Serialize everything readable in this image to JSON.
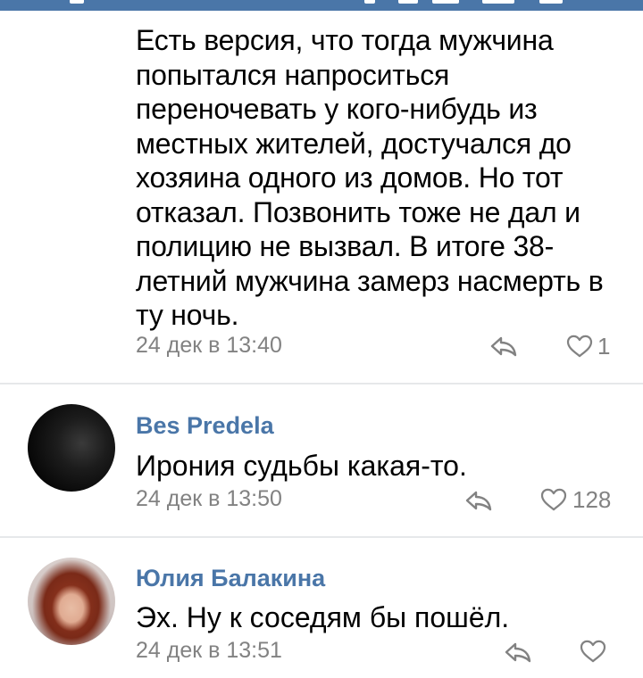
{
  "status_bar": {
    "color": "#4a76a8"
  },
  "colors": {
    "link": "#4a76a8",
    "meta": "#828282",
    "text": "#000000",
    "divider": "#e6e8ea"
  },
  "comments": [
    {
      "text": "Есть версия, что тогда мужчина попытался напроситься переночевать у кого-нибудь из местных жителей, достучался до хозяина одного из домов. Но тот отказал. Позвонить тоже не дал и полицию не вызвал. В итоге 38-летний мужчина замерз насмерть в ту ночь.",
      "time": "24 дек в 13:40",
      "likes": "1",
      "icons": {
        "reply": "reply-arrow-icon",
        "like": "heart-icon"
      }
    },
    {
      "author": "Bes Predela",
      "text": "Ирония судьбы какая-то.",
      "time": "24 дек в 13:50",
      "likes": "128",
      "icons": {
        "reply": "reply-arrow-icon",
        "like": "heart-icon"
      }
    },
    {
      "author": "Юлия Балакина",
      "text": "Эх. Ну к соседям бы пошёл.",
      "time": "24 дек в 13:51",
      "likes": "",
      "icons": {
        "reply": "reply-arrow-icon",
        "like": "heart-icon"
      }
    }
  ]
}
